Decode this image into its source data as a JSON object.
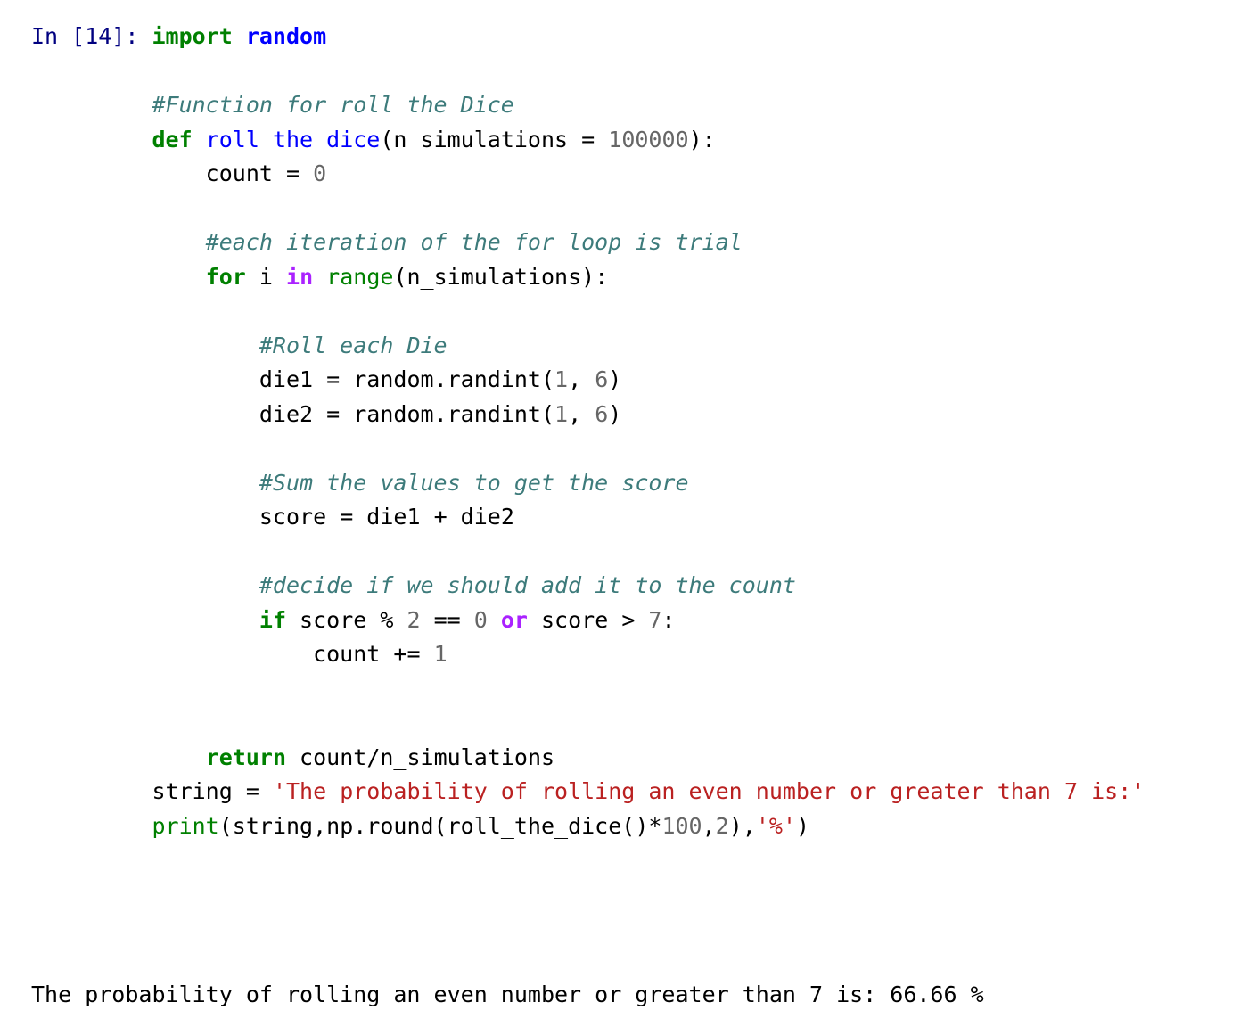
{
  "notebook": {
    "cell": {
      "prompt": "In [14]: ",
      "prompt_number": "14",
      "type": "code",
      "language": "python",
      "lines": [
        {
          "id": "line-import",
          "segments": [
            {
              "t": "import ",
              "c": "k"
            },
            {
              "t": "random",
              "c": "nn"
            }
          ]
        },
        {
          "id": "line-blank-1",
          "segments": [
            {
              "t": "",
              "c": "p"
            }
          ]
        },
        {
          "id": "line-comment-function",
          "segments": [
            {
              "t": "#Function for roll the Dice",
              "c": "c"
            }
          ]
        },
        {
          "id": "line-def",
          "segments": [
            {
              "t": "def ",
              "c": "k"
            },
            {
              "t": "roll_the_dice",
              "c": "nf"
            },
            {
              "t": "(n_simulations ",
              "c": "p"
            },
            {
              "t": "=",
              "c": "p"
            },
            {
              "t": " ",
              "c": "p"
            },
            {
              "t": "100000",
              "c": "m"
            },
            {
              "t": "):",
              "c": "p"
            }
          ]
        },
        {
          "id": "line-count-init",
          "segments": [
            {
              "t": "    count ",
              "c": "p"
            },
            {
              "t": "= ",
              "c": "p"
            },
            {
              "t": "0",
              "c": "m"
            }
          ]
        },
        {
          "id": "line-blank-2",
          "segments": [
            {
              "t": "",
              "c": "p"
            }
          ]
        },
        {
          "id": "line-comment-iteration",
          "segments": [
            {
              "t": "    #each iteration of the for loop is trial",
              "c": "c"
            }
          ]
        },
        {
          "id": "line-for",
          "segments": [
            {
              "t": "    ",
              "c": "p"
            },
            {
              "t": "for ",
              "c": "k"
            },
            {
              "t": "i ",
              "c": "p"
            },
            {
              "t": "in ",
              "c": "ow"
            },
            {
              "t": "range",
              "c": "nb"
            },
            {
              "t": "(n_simulations):",
              "c": "p"
            }
          ]
        },
        {
          "id": "line-blank-3",
          "segments": [
            {
              "t": "",
              "c": "p"
            }
          ]
        },
        {
          "id": "line-comment-roll",
          "segments": [
            {
              "t": "        #Roll each Die",
              "c": "c"
            }
          ]
        },
        {
          "id": "line-die1",
          "segments": [
            {
              "t": "        die1 ",
              "c": "p"
            },
            {
              "t": "= ",
              "c": "p"
            },
            {
              "t": "random",
              "c": "p"
            },
            {
              "t": ".randint(",
              "c": "p"
            },
            {
              "t": "1",
              "c": "m"
            },
            {
              "t": ", ",
              "c": "p"
            },
            {
              "t": "6",
              "c": "m"
            },
            {
              "t": ")",
              "c": "p"
            }
          ]
        },
        {
          "id": "line-die2",
          "segments": [
            {
              "t": "        die2 ",
              "c": "p"
            },
            {
              "t": "= ",
              "c": "p"
            },
            {
              "t": "random",
              "c": "p"
            },
            {
              "t": ".randint(",
              "c": "p"
            },
            {
              "t": "1",
              "c": "m"
            },
            {
              "t": ", ",
              "c": "p"
            },
            {
              "t": "6",
              "c": "m"
            },
            {
              "t": ")",
              "c": "p"
            }
          ]
        },
        {
          "id": "line-blank-4",
          "segments": [
            {
              "t": "",
              "c": "p"
            }
          ]
        },
        {
          "id": "line-comment-sum",
          "segments": [
            {
              "t": "        #Sum the values to get the score",
              "c": "c"
            }
          ]
        },
        {
          "id": "line-score",
          "segments": [
            {
              "t": "        score ",
              "c": "p"
            },
            {
              "t": "= ",
              "c": "p"
            },
            {
              "t": "die1 ",
              "c": "p"
            },
            {
              "t": "+ ",
              "c": "p"
            },
            {
              "t": "die2",
              "c": "p"
            }
          ]
        },
        {
          "id": "line-blank-5",
          "segments": [
            {
              "t": "",
              "c": "p"
            }
          ]
        },
        {
          "id": "line-comment-decide",
          "segments": [
            {
              "t": "        #decide if we should add it to the count",
              "c": "c"
            }
          ]
        },
        {
          "id": "line-if",
          "segments": [
            {
              "t": "        ",
              "c": "p"
            },
            {
              "t": "if ",
              "c": "k"
            },
            {
              "t": "score ",
              "c": "p"
            },
            {
              "t": "% ",
              "c": "p"
            },
            {
              "t": "2 ",
              "c": "m"
            },
            {
              "t": "== ",
              "c": "p"
            },
            {
              "t": "0 ",
              "c": "m"
            },
            {
              "t": "or ",
              "c": "ow"
            },
            {
              "t": "score ",
              "c": "p"
            },
            {
              "t": "> ",
              "c": "p"
            },
            {
              "t": "7",
              "c": "m"
            },
            {
              "t": ":",
              "c": "p"
            }
          ]
        },
        {
          "id": "line-count-increment",
          "segments": [
            {
              "t": "            count ",
              "c": "p"
            },
            {
              "t": "+= ",
              "c": "p"
            },
            {
              "t": "1",
              "c": "m"
            }
          ]
        },
        {
          "id": "line-blank-6",
          "segments": [
            {
              "t": "",
              "c": "p"
            }
          ]
        },
        {
          "id": "line-blank-7",
          "segments": [
            {
              "t": "",
              "c": "p"
            }
          ]
        },
        {
          "id": "line-return",
          "segments": [
            {
              "t": "    ",
              "c": "p"
            },
            {
              "t": "return ",
              "c": "k"
            },
            {
              "t": "count",
              "c": "p"
            },
            {
              "t": "/",
              "c": "p"
            },
            {
              "t": "n_simulations",
              "c": "p"
            }
          ]
        },
        {
          "id": "line-string-assign",
          "segments": [
            {
              "t": "string ",
              "c": "p"
            },
            {
              "t": "= ",
              "c": "p"
            },
            {
              "t": "'The probability of rolling an even number or greater than 7 is:'",
              "c": "s"
            }
          ]
        },
        {
          "id": "line-print",
          "segments": [
            {
              "t": "print",
              "c": "nb"
            },
            {
              "t": "(string,np",
              "c": "p"
            },
            {
              "t": ".round(roll_the_dice()",
              "c": "p"
            },
            {
              "t": "*",
              "c": "p"
            },
            {
              "t": "100",
              "c": "m"
            },
            {
              "t": ",",
              "c": "p"
            },
            {
              "t": "2",
              "c": "m"
            },
            {
              "t": "),",
              "c": "p"
            },
            {
              "t": "'%'",
              "c": "s"
            },
            {
              "t": ")",
              "c": "p"
            }
          ]
        }
      ]
    },
    "output": {
      "stream": "stdout",
      "text": "The probability of rolling an even number or greater than 7 is: 66.66 %",
      "message_prefix": "The probability of rolling an even number or greater than 7 is:",
      "value": "66.66",
      "unit": "%"
    }
  },
  "colors": {
    "prompt": "#000080",
    "keyword": "#008000",
    "operator_word": "#aa22ff",
    "builtin": "#008000",
    "function_name": "#0000ff",
    "module": "#0000ff",
    "comment": "#3d7b7b",
    "number": "#666666",
    "string": "#ba2121",
    "text": "#000000",
    "background": "#ffffff"
  }
}
